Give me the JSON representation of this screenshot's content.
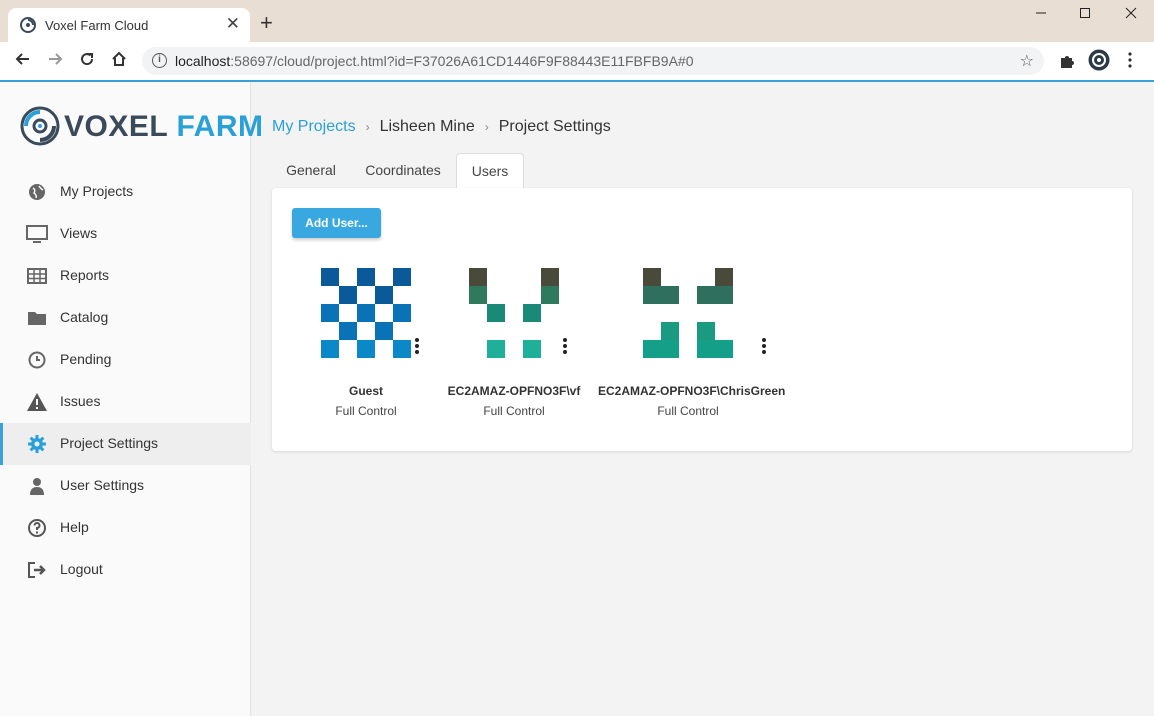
{
  "browser": {
    "tab_title": "Voxel Farm Cloud",
    "tab_close": "✕",
    "new_tab": "+",
    "url_host": "localhost",
    "url_rest": ":58697/cloud/project.html?id=F37026A61CD1446F9F88443E11FBFB9A#0"
  },
  "logo": {
    "voxel": "VOXEL",
    "farm": "FARM"
  },
  "sidebar": {
    "items": [
      {
        "label": "My Projects",
        "icon": "globe-icon"
      },
      {
        "label": "Views",
        "icon": "monitor-icon"
      },
      {
        "label": "Reports",
        "icon": "table-icon"
      },
      {
        "label": "Catalog",
        "icon": "folder-icon"
      },
      {
        "label": "Pending",
        "icon": "clock-icon"
      },
      {
        "label": "Issues",
        "icon": "warning-icon"
      },
      {
        "label": "Project Settings",
        "icon": "gear-icon"
      },
      {
        "label": "User Settings",
        "icon": "user-icon"
      },
      {
        "label": "Help",
        "icon": "help-icon"
      },
      {
        "label": "Logout",
        "icon": "logout-icon"
      }
    ],
    "active": "Project Settings"
  },
  "breadcrumb": {
    "root": "My Projects",
    "project": "Lisheen Mine",
    "page": "Project Settings",
    "sep": "›"
  },
  "tabs": [
    "General",
    "Coordinates",
    "Users"
  ],
  "active_tab": "Users",
  "add_user_label": "Add User...",
  "users": [
    {
      "name": "Guest",
      "role": "Full Control"
    },
    {
      "name": "EC2AMAZ-OPFNO3F\\vf",
      "role": "Full Control"
    },
    {
      "name": "EC2AMAZ-OPFNO3F\\ChrisGreen",
      "role": "Full Control"
    }
  ],
  "colors": {
    "accent": "#2aa0d8",
    "guest_avatar": [
      "#0a5a9a",
      "#0a73b8",
      "#0a88c8"
    ],
    "vf_avatar": [
      "#4a4a3a",
      "#2f7a5e",
      "#1a9a84",
      "#20b09a"
    ],
    "chris_avatar": [
      "#4a4a3a",
      "#2f6f5e",
      "#1a9a80"
    ]
  }
}
